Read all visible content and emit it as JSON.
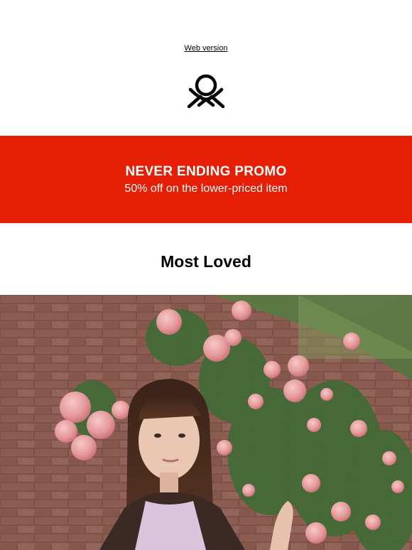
{
  "header": {
    "web_version_label": "Web version",
    "logo_icon": "benetton-knot-logo"
  },
  "promo": {
    "title": "NEVER ENDING PROMO",
    "subtitle": "50% off on the lower-priced item",
    "background_color": "#e61e05"
  },
  "section": {
    "title": "Most Loved"
  },
  "hero": {
    "alt": "Woman leaning against a brick wall covered in pink climbing roses"
  }
}
